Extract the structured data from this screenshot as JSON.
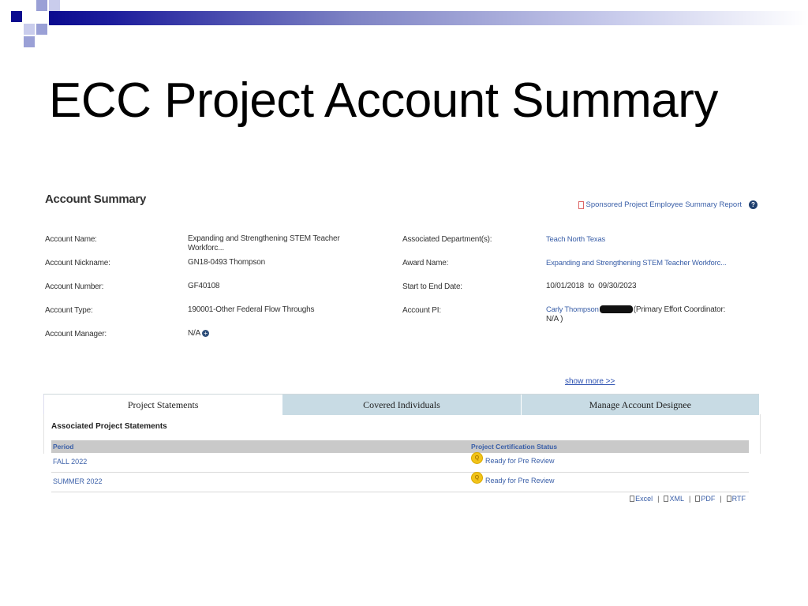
{
  "slide": {
    "title": "ECC Project Account Summary",
    "accent_colors": [
      "#0b0b8f",
      "#7e83c4",
      "#c9ccec"
    ]
  },
  "panel": {
    "title": "Account Summary",
    "report_link": "Sponsored Project Employee Summary Report",
    "help_icon": "help-icon"
  },
  "fields": {
    "account_name": {
      "label": "Account Name:",
      "value_line1": "Expanding and Strengthening STEM Teacher",
      "value_line2": "Workforc..."
    },
    "account_nickname": {
      "label": "Account Nickname:",
      "value": "GN18-0493 Thompson"
    },
    "account_number": {
      "label": "Account Number:",
      "value": "GF40108"
    },
    "account_type": {
      "label": "Account Type:",
      "value": "190001-Other Federal Flow Throughs"
    },
    "account_manager": {
      "label": "Account Manager:",
      "value": "N/A"
    },
    "associated_department": {
      "label": "Associated Department(s):",
      "value": "Teach North Texas"
    },
    "award_name": {
      "label": "Award Name:",
      "value": "Expanding and Strengthening STEM Teacher Workforc..."
    },
    "start_end_date": {
      "label": "Start to End Date:",
      "value": "10/01/2018  to  09/30/2023"
    },
    "account_pi": {
      "label": "Account PI:",
      "name": "Carly Thompson",
      "role": "(Primary Effort Coordinator:",
      "role_line2": "N/A )"
    }
  },
  "show_more": "show more >>",
  "tabs": [
    {
      "label": "Project Statements",
      "active": true
    },
    {
      "label": "Covered Individuals",
      "active": false
    },
    {
      "label": "Manage Account Designee",
      "active": false
    }
  ],
  "statements": {
    "section_title": "Associated Project Statements",
    "columns": [
      "Period",
      "Project Certification Status"
    ],
    "rows": [
      {
        "period": "FALL 2022",
        "status": "Ready for Pre Review"
      },
      {
        "period": "SUMMER 2022",
        "status": "Ready for Pre Review"
      }
    ]
  },
  "exports": [
    "Excel",
    "XML",
    "PDF",
    "RTF"
  ]
}
